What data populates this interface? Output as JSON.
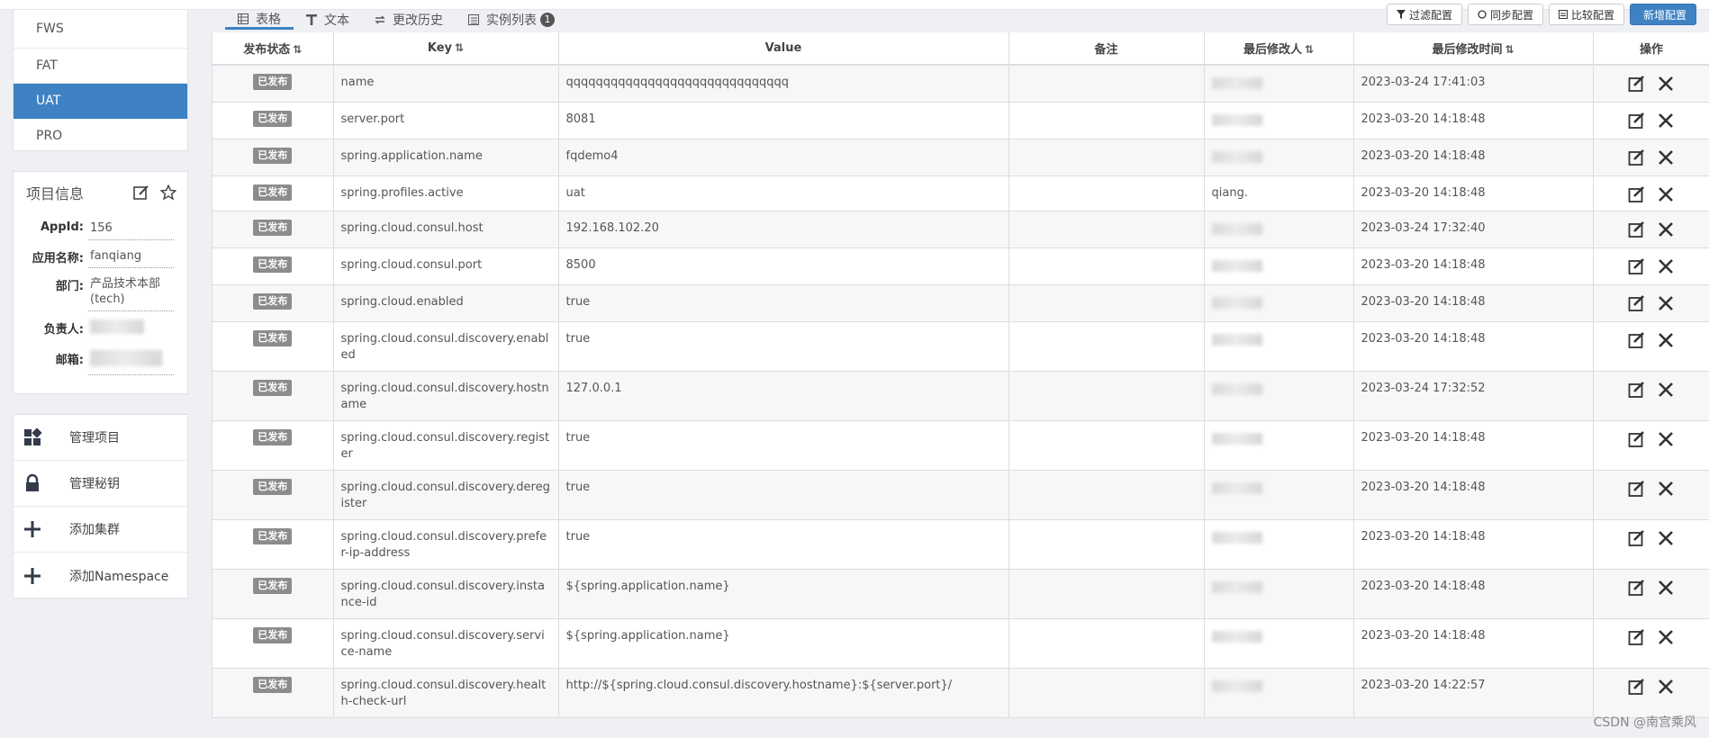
{
  "environments": [
    {
      "label": "FWS",
      "active": false
    },
    {
      "label": "FAT",
      "active": false
    },
    {
      "label": "UAT",
      "active": true
    },
    {
      "label": "PRO",
      "active": false
    }
  ],
  "project_info": {
    "title": "项目信息",
    "appid_label": "AppId:",
    "appid": "156",
    "app_name_label": "应用名称:",
    "app_name": "fanqiang",
    "dept_label": "部门:",
    "dept": "产品技术本部(tech)",
    "owner_label": "负责人:",
    "email_label": "邮箱:"
  },
  "menu": [
    {
      "label": "管理项目",
      "icon": "dashboard-icon"
    },
    {
      "label": "管理秘钥",
      "icon": "lock-icon"
    },
    {
      "label": "添加集群",
      "icon": "plus-icon"
    },
    {
      "label": "添加Namespace",
      "icon": "plus-icon"
    }
  ],
  "tabs": [
    {
      "label": "表格",
      "icon": "table-icon",
      "active": true
    },
    {
      "label": "文本",
      "icon": "text-icon",
      "active": false
    },
    {
      "label": "更改历史",
      "icon": "history-icon",
      "active": false
    },
    {
      "label": "实例列表",
      "icon": "list-icon",
      "active": false,
      "badge": "1"
    }
  ],
  "actions": [
    {
      "label": "过滤配置",
      "icon": "filter-icon",
      "primary": false
    },
    {
      "label": "同步配置",
      "icon": "sync-icon",
      "primary": false
    },
    {
      "label": "比较配置",
      "icon": "compare-icon",
      "primary": false
    },
    {
      "label": "新增配置",
      "icon": "plus-icon",
      "primary": true
    }
  ],
  "table": {
    "headers": {
      "status": "发布状态",
      "key": "Key",
      "value": "Value",
      "comment": "备注",
      "modifier": "最后修改人",
      "time": "最后修改时间",
      "ops": "操作"
    },
    "rows": [
      {
        "status": "已发布",
        "key": "name",
        "value": "qqqqqqqqqqqqqqqqqqqqqqqqqqqqqq",
        "comment": "",
        "modifier": "",
        "time": "2023-03-24 17:41:03"
      },
      {
        "status": "已发布",
        "key": "server.port",
        "value": "8081",
        "comment": "",
        "modifier": "",
        "time": "2023-03-20 14:18:48"
      },
      {
        "status": "已发布",
        "key": "spring.application.name",
        "value": "fqdemo4",
        "comment": "",
        "modifier": "",
        "time": "2023-03-20 14:18:48"
      },
      {
        "status": "已发布",
        "key": "spring.profiles.active",
        "value": "uat",
        "comment": "",
        "modifier": "qiang.",
        "time": "2023-03-20 14:18:48"
      },
      {
        "status": "已发布",
        "key": "spring.cloud.consul.host",
        "value": "192.168.102.20",
        "comment": "",
        "modifier": "",
        "time": "2023-03-24 17:32:40"
      },
      {
        "status": "已发布",
        "key": "spring.cloud.consul.port",
        "value": "8500",
        "comment": "",
        "modifier": "",
        "time": "2023-03-20 14:18:48"
      },
      {
        "status": "已发布",
        "key": "spring.cloud.enabled",
        "value": "true",
        "comment": "",
        "modifier": "",
        "time": "2023-03-20 14:18:48"
      },
      {
        "status": "已发布",
        "key": "spring.cloud.consul.discovery.enabled",
        "value": "true",
        "comment": "",
        "modifier": "",
        "time": "2023-03-20 14:18:48"
      },
      {
        "status": "已发布",
        "key": "spring.cloud.consul.discovery.hostname",
        "value": "127.0.0.1",
        "comment": "",
        "modifier": "",
        "time": "2023-03-24 17:32:52"
      },
      {
        "status": "已发布",
        "key": "spring.cloud.consul.discovery.register",
        "value": "true",
        "comment": "",
        "modifier": "",
        "time": "2023-03-20 14:18:48"
      },
      {
        "status": "已发布",
        "key": "spring.cloud.consul.discovery.deregister",
        "value": "true",
        "comment": "",
        "modifier": "",
        "time": "2023-03-20 14:18:48"
      },
      {
        "status": "已发布",
        "key": "spring.cloud.consul.discovery.prefer-ip-address",
        "value": "true",
        "comment": "",
        "modifier": "",
        "time": "2023-03-20 14:18:48"
      },
      {
        "status": "已发布",
        "key": "spring.cloud.consul.discovery.instance-id",
        "value": "${spring.application.name}",
        "comment": "",
        "modifier": "",
        "time": "2023-03-20 14:18:48"
      },
      {
        "status": "已发布",
        "key": "spring.cloud.consul.discovery.service-name",
        "value": "${spring.application.name}",
        "comment": "",
        "modifier": "",
        "time": "2023-03-20 14:18:48"
      },
      {
        "status": "已发布",
        "key": "spring.cloud.consul.discovery.health-check-url",
        "value": "http://${spring.cloud.consul.discovery.hostname}:${server.port}/",
        "comment": "",
        "modifier": "",
        "time": "2023-03-20 14:22:57"
      }
    ]
  },
  "watermark": "CSDN @南宫乘风"
}
